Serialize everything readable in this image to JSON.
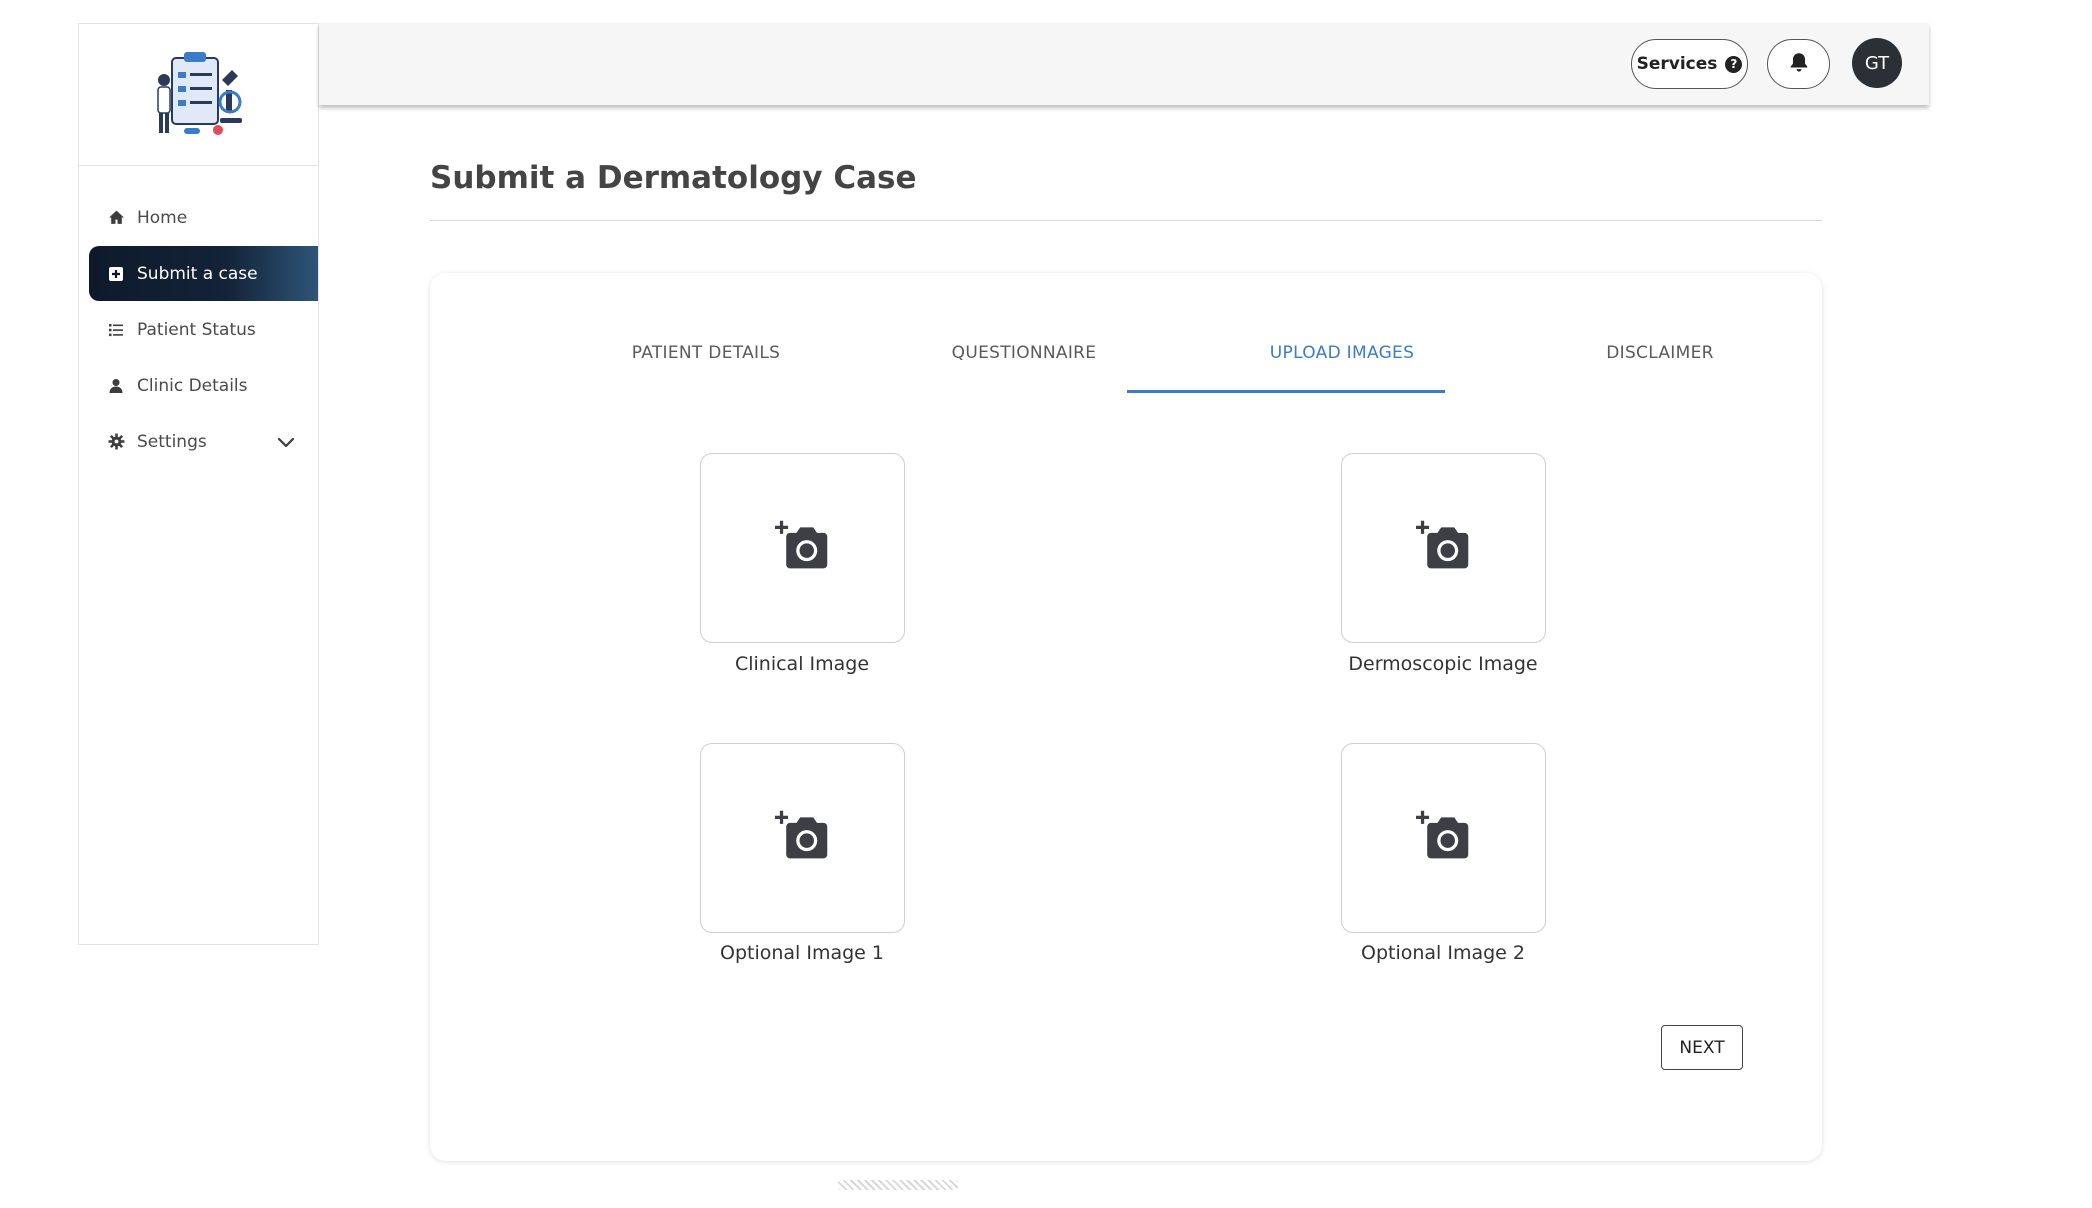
{
  "sidebar": {
    "items": [
      {
        "label": "Home",
        "icon": "home-icon"
      },
      {
        "label": "Submit a case",
        "icon": "plus-square-icon",
        "active": true
      },
      {
        "label": "Patient Status",
        "icon": "list-icon"
      },
      {
        "label": "Clinic Details",
        "icon": "user-icon"
      },
      {
        "label": "Settings",
        "icon": "gear-icon",
        "expandable": true
      }
    ]
  },
  "header": {
    "services_label": "Services",
    "services_help_icon": "?",
    "bell_icon": "bell-icon",
    "avatar_initials": "GT"
  },
  "main": {
    "title": "Submit a Dermatology Case",
    "tabs": [
      {
        "label": "PATIENT DETAILS"
      },
      {
        "label": "QUESTIONNAIRE"
      },
      {
        "label": "UPLOAD IMAGES",
        "active": true
      },
      {
        "label": "DISCLAIMER"
      }
    ],
    "uploads": [
      {
        "label": "Clinical Image",
        "icon": "add-photo-icon"
      },
      {
        "label": "Dermoscopic Image",
        "icon": "add-photo-icon"
      },
      {
        "label": "Optional Image 1",
        "icon": "add-photo-icon"
      },
      {
        "label": "Optional Image 2",
        "icon": "add-photo-icon"
      }
    ],
    "next_label": "NEXT"
  },
  "colors": {
    "accent": "#3a7cc7",
    "sidebar_active_start": "#0e1a2b",
    "sidebar_active_end": "#2e5577",
    "avatar_bg": "#2b2f36"
  }
}
